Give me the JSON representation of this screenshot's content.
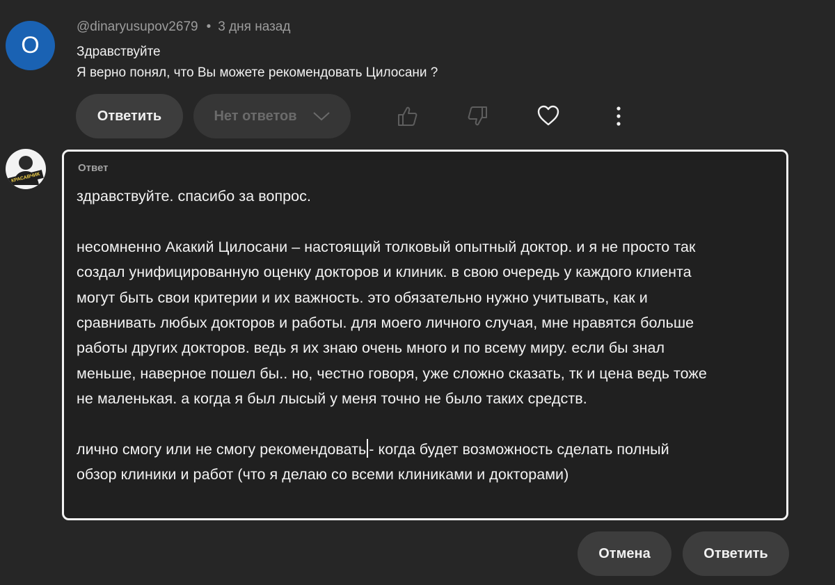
{
  "comment": {
    "avatar_letter": "О",
    "author": "@dinaryusupov2679",
    "separator": "•",
    "time": "3 дня назад",
    "lines": [
      "Здравствуйте",
      "Я верно понял, что Вы можете рекомендовать Цилосани ?"
    ],
    "reply_button": "Ответить",
    "no_replies_button": "Нет ответов",
    "icons": [
      "thumbs-up-icon",
      "thumbs-down-icon",
      "heart-icon",
      "more-vertical-icon"
    ]
  },
  "reply": {
    "avatar_badge": "КРАСАВЧИК",
    "label": "Ответ",
    "paragraphs": [
      [
        "здравствуйте. спасибо за вопрос."
      ],
      [
        "несомненно Акакий Цилосани – настоящий толковый опытный доктор. и я не просто так",
        "создал унифицированную оценку докторов и клиник. в свою очередь у каждого клиента",
        "могут быть свои критерии и их важность. это обязательно нужно учитывать, как и",
        "сравнивать любых докторов и работы. для моего личного случая, мне нравятся больше",
        "работы других докторов. ведь я их знаю очень много и по всему миру. если бы знал",
        "меньше, наверное пошел бы.. но, честно говоря, уже сложно сказать, тк и цена ведь тоже",
        "не маленькая. а когда я был лысый у меня точно не было таких средств."
      ],
      [
        "лично смогу или не смогу рекомендовать",
        "обзор клиники и работ (что я делаю со всеми клиниками и докторами)"
      ]
    ],
    "last_para_line1_after_caret": "- когда будет возможность сделать полный",
    "cancel_button": "Отмена",
    "submit_button": "Ответить"
  }
}
